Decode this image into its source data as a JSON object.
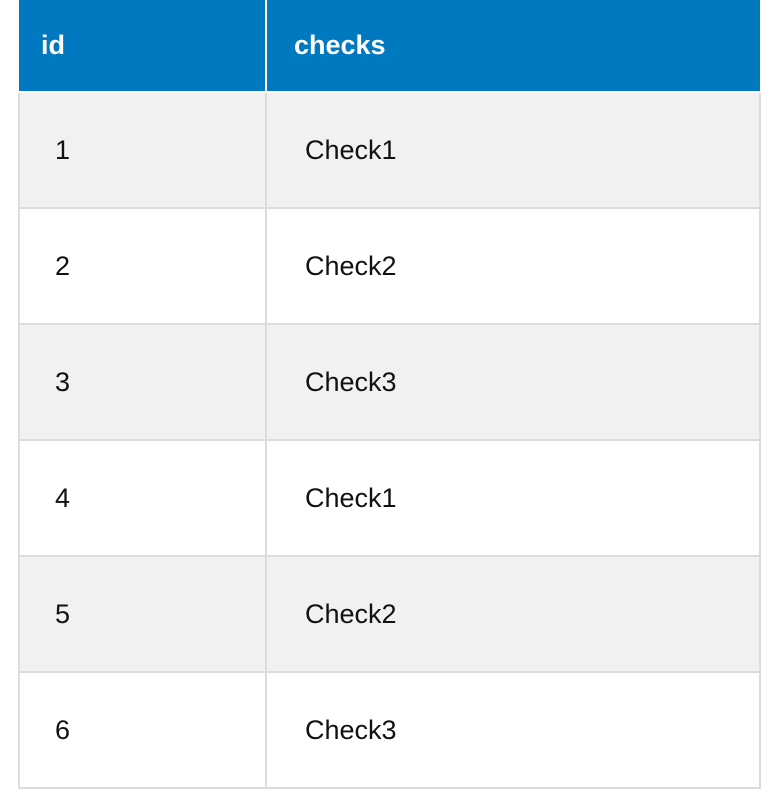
{
  "colors": {
    "header_bg": "#0079c1",
    "header_text": "#ffffff",
    "row_odd_bg": "#f1f1f1",
    "row_even_bg": "#ffffff",
    "grid": "#dcdcdc"
  },
  "table": {
    "columns": [
      "id",
      "checks"
    ],
    "rows": [
      [
        "1",
        "Check1"
      ],
      [
        "2",
        "Check2"
      ],
      [
        "3",
        "Check3"
      ],
      [
        "4",
        "Check1"
      ],
      [
        "5",
        "Check2"
      ],
      [
        "6",
        "Check3"
      ]
    ]
  }
}
